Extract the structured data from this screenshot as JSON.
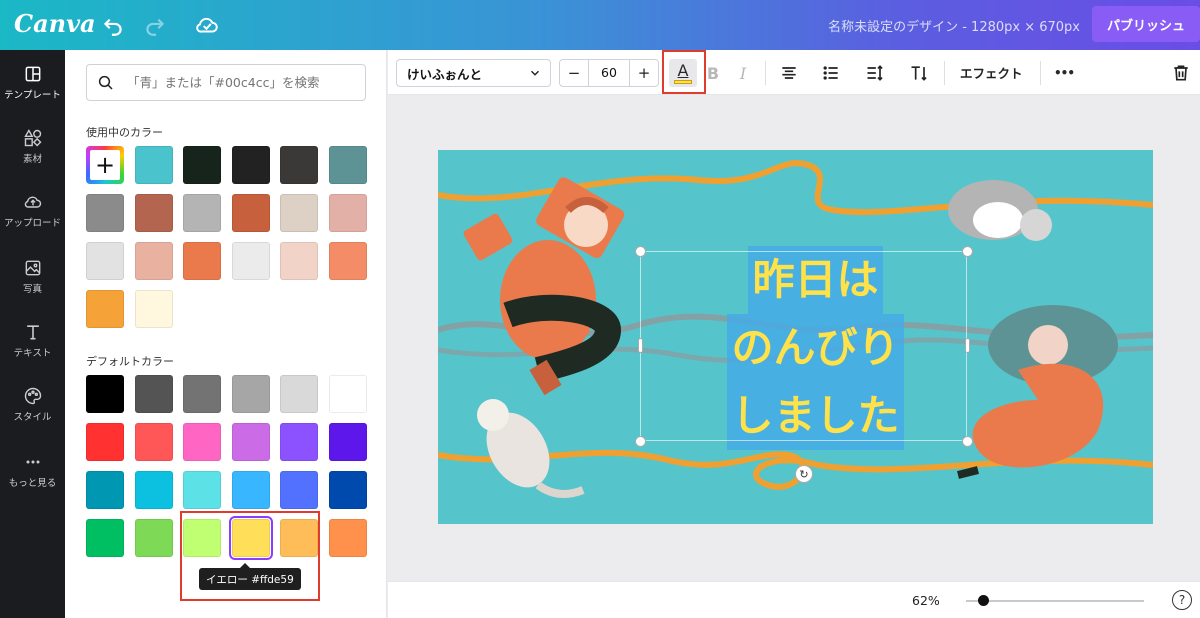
{
  "app": {
    "logo": "Canva",
    "doc_title": "名称未設定のデザイン - 1280px × 670px",
    "publish_label": "パブリッシュ"
  },
  "rail": {
    "items": [
      {
        "label": "テンプレート",
        "icon": "template-icon"
      },
      {
        "label": "素材",
        "icon": "elements-icon"
      },
      {
        "label": "アップロード",
        "icon": "upload-icon"
      },
      {
        "label": "写真",
        "icon": "photo-icon"
      },
      {
        "label": "テキスト",
        "icon": "text-icon"
      },
      {
        "label": "スタイル",
        "icon": "palette-icon"
      },
      {
        "label": "もっと見る",
        "icon": "more-icon"
      }
    ]
  },
  "panel": {
    "search_placeholder": "「青」または「#00c4cc」を検索",
    "used_label": "使用中のカラー",
    "default_label": "デフォルトカラー",
    "used_colors": [
      "#4bc3cc",
      "#16241c",
      "#222222",
      "#3b3838",
      "#5e9396",
      "#8b8b8b",
      "#b3654f",
      "#b4b4b4",
      "#c6603d",
      "#ddd0c4",
      "#e3b0a8",
      "#e2e2e2",
      "#e9b2a0",
      "#ea7a4c",
      "#ebebeb",
      "#f2d3c7",
      "#f48c67",
      "#f5a238",
      "#fff8de"
    ],
    "default_colors": [
      "#000000",
      "#545454",
      "#737373",
      "#a6a6a6",
      "#d9d9d9",
      "#ffffff",
      "#ff3131",
      "#ff5757",
      "#ff66c4",
      "#cb6ce6",
      "#8c52ff",
      "#5e17eb",
      "#0097b2",
      "#0cc0df",
      "#5ce1e6",
      "#38b6ff",
      "#5271ff",
      "#004aad",
      "#00bf63",
      "#7ed957",
      "#c1ff72",
      "#ffde59",
      "#ffbd59",
      "#ff914d"
    ],
    "selected_index": 21,
    "tooltip": "イエロー #ffde59"
  },
  "toolbar": {
    "font": "けいふぉんと",
    "size": "60",
    "minus": "−",
    "plus": "+",
    "color_letter": "A",
    "bold": "B",
    "italic": "I",
    "effect_label": "エフェクト",
    "more": "•••"
  },
  "canvas": {
    "headline_lines": [
      "昨日は",
      "のんびり",
      "しました"
    ]
  },
  "bottom": {
    "zoom": "62%",
    "zoom_percent": 62,
    "help": "?"
  }
}
